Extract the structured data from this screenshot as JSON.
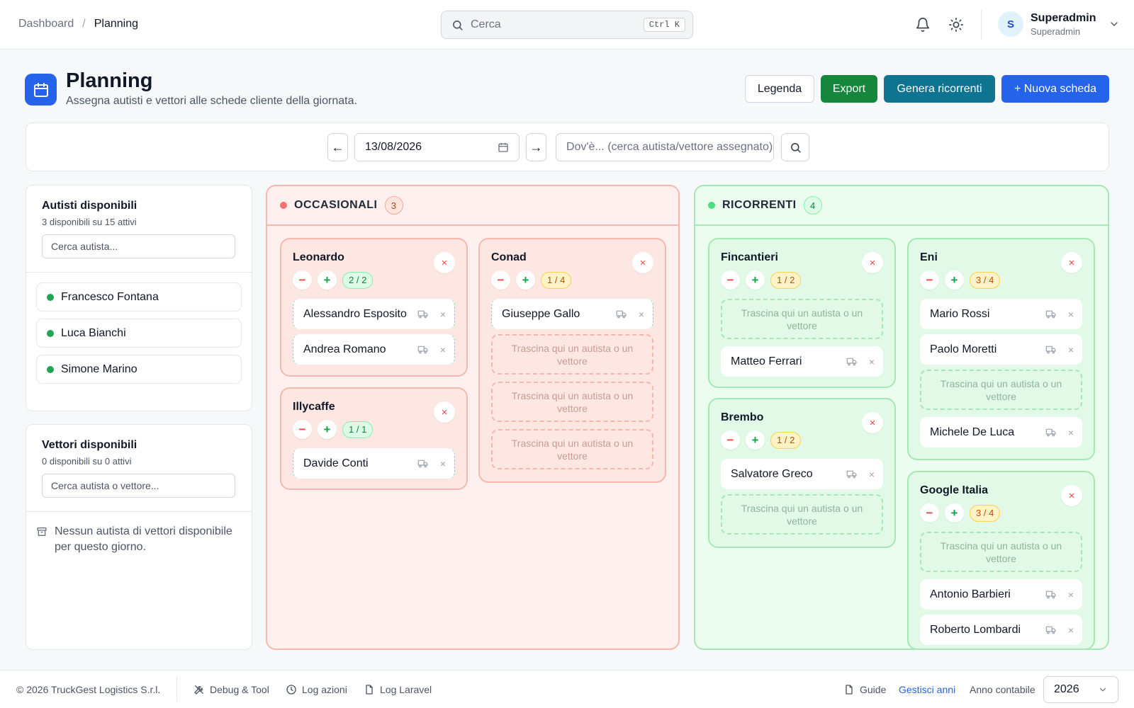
{
  "breadcrumb": {
    "parent": "Dashboard",
    "separator": "/",
    "current": "Planning"
  },
  "search": {
    "placeholder": "Cerca",
    "shortcut": "Ctrl K"
  },
  "user": {
    "initial": "S",
    "name": "Superadmin",
    "role": "Superadmin"
  },
  "page": {
    "title": "Planning",
    "subtitle": "Assegna autisti e vettori alle schede cliente della giornata."
  },
  "actions": {
    "legenda": "Legenda",
    "export": "Export",
    "genera": "Genera ricorrenti",
    "nuova": "+ Nuova scheda"
  },
  "filter": {
    "prev": "←",
    "next": "→",
    "date": "13/08/2026",
    "where_placeholder": "Dov'è... (cerca autista/vettore assegnato)"
  },
  "drivers_panel": {
    "title": "Autisti disponibili",
    "subtitle": "3 disponibili su 15 attivi",
    "search_placeholder": "Cerca autista...",
    "items": [
      "Francesco Fontana",
      "Luca Bianchi",
      "Simone Marino"
    ]
  },
  "carriers_panel": {
    "title": "Vettori disponibili",
    "subtitle": "0 disponibili su 0 attivi",
    "search_placeholder": "Cerca autista o vettore...",
    "empty_message": "Nessun autista di vettori disponibile per questo giorno."
  },
  "drop_text": "Trascina qui un autista o un vettore",
  "occasionali": {
    "title": "OCCASIONALI",
    "count": "3",
    "dot_color": "#f87171",
    "cards": [
      {
        "name": "Leonardo",
        "capacity": "2 / 2",
        "drivers": [
          "Alessandro Esposito",
          "Andrea Romano"
        ]
      },
      {
        "name": "Conad",
        "capacity": "1 / 4",
        "drivers": [
          "Giuseppe Gallo"
        ]
      },
      {
        "name": "Illycaffe",
        "capacity": "1 / 1",
        "drivers": [
          "Davide Conti"
        ]
      }
    ]
  },
  "ricorrenti": {
    "title": "RICORRENTI",
    "count": "4",
    "dot_color": "#4ade80",
    "cards": [
      {
        "name": "Fincantieri",
        "capacity": "1 / 2",
        "drivers": [
          "Matteo Ferrari"
        ]
      },
      {
        "name": "Eni",
        "capacity": "3 / 4",
        "drivers": [
          "Mario Rossi",
          "Paolo Moretti",
          "Michele De Luca"
        ]
      },
      {
        "name": "Brembo",
        "capacity": "1 / 2",
        "drivers": [
          "Salvatore Greco"
        ]
      },
      {
        "name": "Google Italia",
        "capacity": "3 / 4",
        "drivers": [
          "Antonio Barbieri",
          "Roberto Lombardi"
        ]
      }
    ]
  },
  "footer": {
    "copyright": "© 2026 TruckGest Logistics S.r.l.",
    "debug": "Debug & Tool",
    "log_azioni": "Log azioni",
    "log_laravel": "Log Laravel",
    "guide": "Guide",
    "gestisci_anni": "Gestisci anni",
    "anno_label": "Anno contabile",
    "anno_value": "2026"
  },
  "icons": {
    "close": "×",
    "minus": "−",
    "plus": "+"
  }
}
